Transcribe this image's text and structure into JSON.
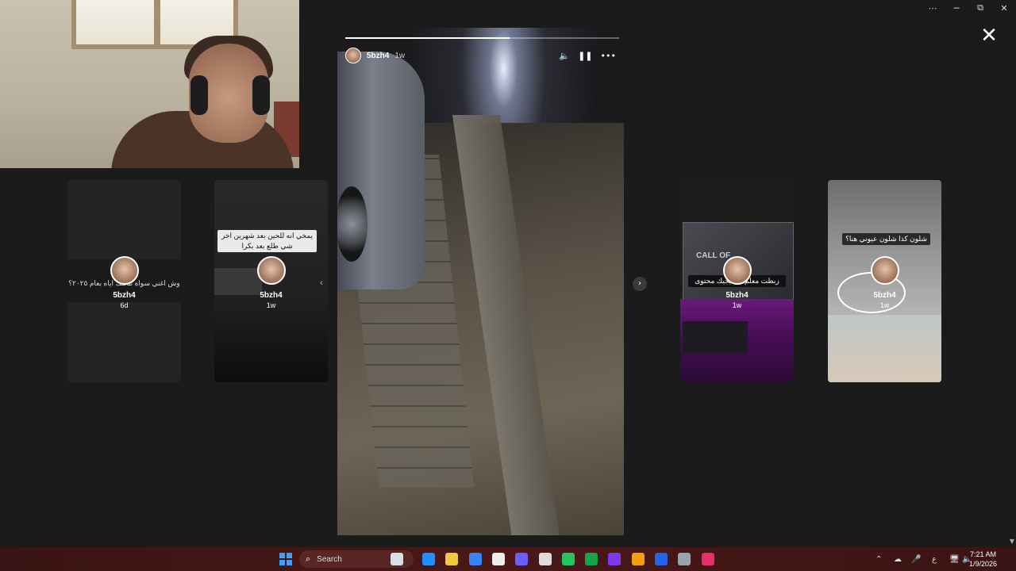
{
  "window_controls": {
    "more": "⋯",
    "minimize": "─",
    "restore": "⧉",
    "close": "✕"
  },
  "viewer": {
    "close_glyph": "✕",
    "next_glyph": "›"
  },
  "main_story": {
    "username": "5bzh4",
    "age": "1w",
    "progress": 0.6,
    "mute_glyph": "🔈",
    "pause_glyph": "❚❚",
    "more_glyph": "•••"
  },
  "side_stories": [
    {
      "username": "5bzh4",
      "age": "6d",
      "caption": "وش اغني سواه تتخلك اياه بعام ٢٠٢٥؟"
    },
    {
      "username": "5bzh4",
      "age": "1w",
      "caption": "يمخي انه للحين بعد شهرين اخر شي طلع بعد بكرا",
      "arrow": "‹"
    },
    {
      "username": "5bzh4",
      "age": "1w",
      "caption": "زبطت معلم الا ديجيك محتوى",
      "screen_text": "CALL OF"
    },
    {
      "username": "5bzh4",
      "age": "1w",
      "caption": "شلون كذا شلون عيوني هنا؟"
    }
  ],
  "taskbar": {
    "search_placeholder": "Search",
    "search_icon": "search-icon",
    "tray_up": "⌃",
    "tray_lang": "ع",
    "time": "7:21 AM",
    "date": "1/9/2026",
    "app_colors": [
      "#d8e0e6",
      "#1e90ff",
      "#f5c542",
      "#3b82f6",
      "#eeeeee",
      "#6d5dfc",
      "#dcdcdc",
      "#22c55e",
      "#16a34a",
      "#7c3aed",
      "#f59e0b",
      "#2563eb",
      "#9ca3af",
      "#e1306c"
    ]
  },
  "scroll_arrow": "▼"
}
